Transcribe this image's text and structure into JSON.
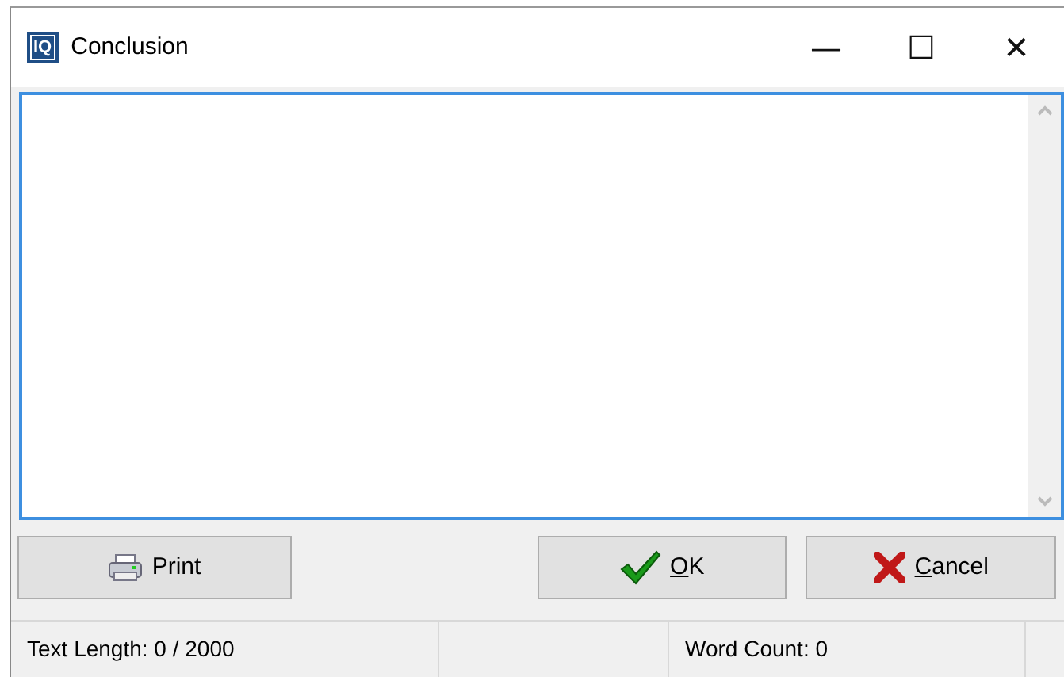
{
  "window": {
    "logo": "IQ",
    "title": "Conclusion",
    "controls": [
      "—",
      "☐",
      "✕"
    ]
  },
  "editor": {
    "focused": true
  },
  "buttons": [
    {
      "kind": "print",
      "label": "Print",
      "mnemonic": false
    },
    {
      "kind": "ok",
      "label": "OK",
      "mnemonic": true
    },
    {
      "kind": "cancel",
      "label": "Cancel",
      "mnemonic": true
    }
  ],
  "status_bar": {
    "text_length": "Text Length: 0 / 2000",
    "word_count": "Word Count: 0"
  }
}
